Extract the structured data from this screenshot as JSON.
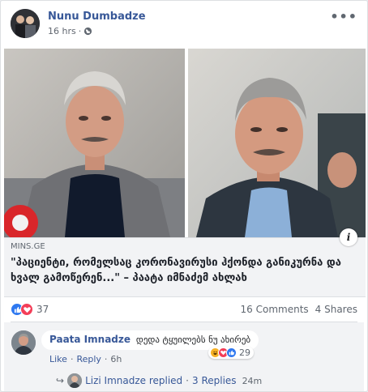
{
  "post": {
    "author": "Nunu Dumbadze",
    "time": "16 hrs",
    "more_label": "•••"
  },
  "link_preview": {
    "domain": "MINS.GE",
    "headline": "\"პაციენტი, რომელსაც კორონავირუსი ჰქონდა განიკურნა და ხვალ გამოწერენ...\" – პაატა იმნაძემ ახლახ",
    "info_label": "i"
  },
  "stats": {
    "reaction_count": "37",
    "comments": "16 Comments",
    "shares": "4 Shares"
  },
  "comment": {
    "name": "Paata Imnadze",
    "text": "დედა ტყუილებს ნუ ახირებ",
    "like": "Like",
    "reply": "Reply",
    "dot": "·",
    "time": "6h",
    "reaction_count": "29"
  },
  "replies": {
    "arrow": "↪",
    "replied": "Lizi Imnadze replied",
    "count": "3 Replies",
    "time": "24m"
  },
  "icons": {
    "globe": "globe-icon",
    "like": "like-reaction-icon",
    "love": "love-reaction-icon",
    "haha": "haha-reaction-icon"
  },
  "colors": {
    "brand_link": "#385898",
    "like_blue": "#2e78f0",
    "love_red": "#f33e58",
    "haha_yellow": "#f7b125"
  }
}
